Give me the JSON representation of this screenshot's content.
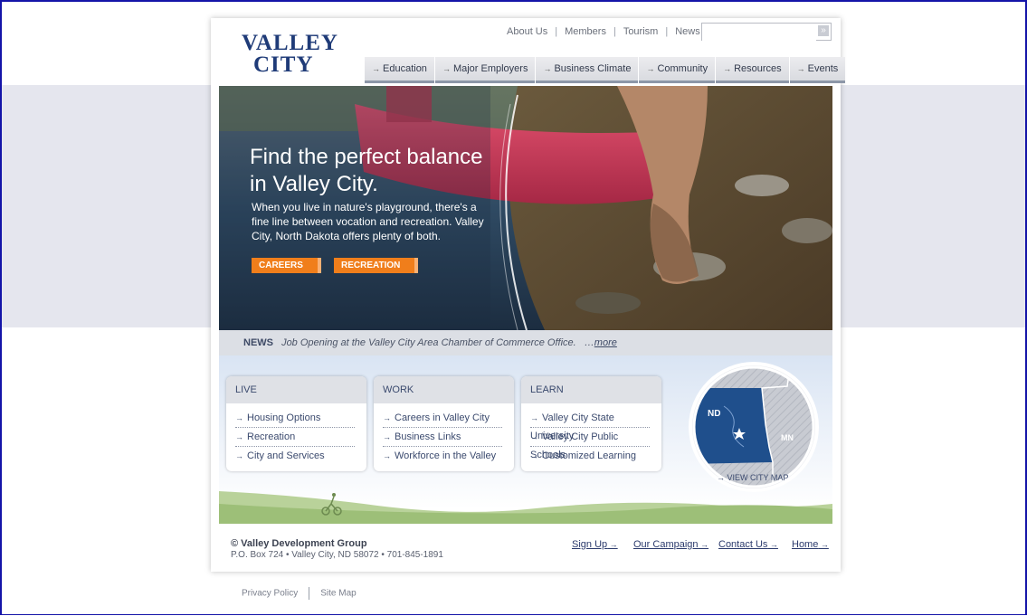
{
  "logo": {
    "line1": "VALLEY",
    "line2": "CITY"
  },
  "utility_nav": [
    "About Us",
    "Members",
    "Tourism",
    "News"
  ],
  "search": {
    "placeholder": "",
    "button_glyph": "»"
  },
  "main_nav": [
    {
      "label": "Education"
    },
    {
      "label": "Major Employers"
    },
    {
      "label": "Business Climate"
    },
    {
      "label": "Community"
    },
    {
      "label": "Resources"
    },
    {
      "label": "Events"
    }
  ],
  "hero": {
    "headline": "Find the perfect balance in Valley City.",
    "body": "When you live in nature's playground, there's a fine line between vocation and recreation. Valley City, North Dakota offers plenty of both.",
    "buttons": [
      "CAREERS",
      "RECREATION"
    ]
  },
  "news": {
    "label": "NEWS",
    "text": "Job Opening at the Valley City Area Chamber of Commerce Office.",
    "ellipsis": "…",
    "more": "more"
  },
  "cards": [
    {
      "title": "LIVE",
      "links": [
        "Housing Options",
        "Recreation",
        "City and Services"
      ]
    },
    {
      "title": "WORK",
      "links": [
        "Careers in Valley City",
        "Business Links",
        "Workforce in the Valley"
      ]
    },
    {
      "title": "LEARN",
      "links": [
        "Valley City State University",
        "Valley City Public Schools",
        "Customized Learning"
      ]
    }
  ],
  "map": {
    "state_left": "ND",
    "state_right": "MN",
    "link": "VIEW CITY MAP"
  },
  "footer": {
    "org": "© Valley Development Group",
    "address": "P.O. Box 724 • Valley City, ND 58072 • 701-845-1891",
    "links": [
      "Sign Up",
      "Our Campaign",
      "Contact Us",
      "Home"
    ]
  },
  "below_links": [
    "Privacy Policy",
    "Site Map"
  ],
  "colors": {
    "brand_blue": "#1f3b78",
    "accent_orange": "#f07e1b",
    "map_nd": "#1f4f8c"
  }
}
